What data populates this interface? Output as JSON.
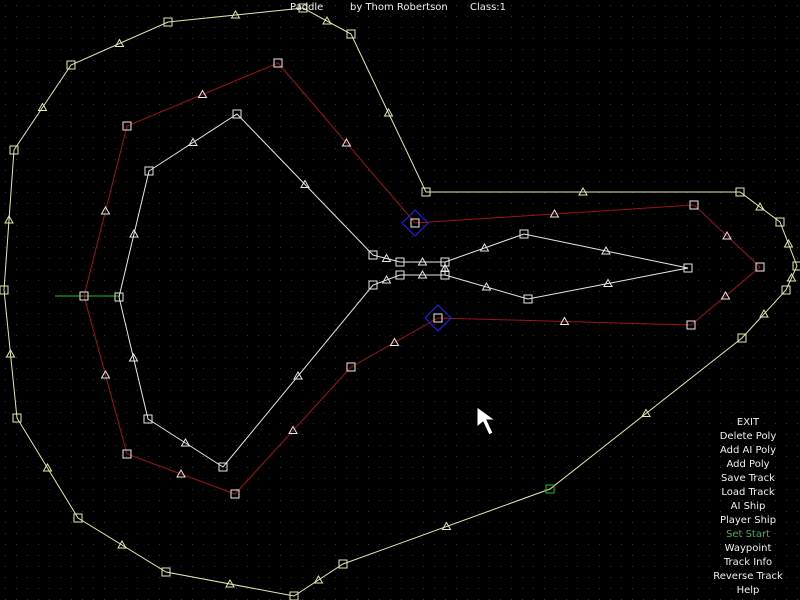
{
  "header": {
    "track_name": "Paddle",
    "author": "by Thom Robertson",
    "class_label": "Class:1"
  },
  "menu": {
    "items": [
      {
        "label": "EXIT"
      },
      {
        "label": "Delete Poly"
      },
      {
        "label": "Add AI Poly"
      },
      {
        "label": "Add Poly"
      },
      {
        "label": "Save Track"
      },
      {
        "label": "Load Track"
      },
      {
        "label": "AI Ship"
      },
      {
        "label": "Player Ship"
      },
      {
        "label": "Set Start",
        "active": true
      },
      {
        "label": "Waypoint"
      },
      {
        "label": "Track Info"
      },
      {
        "label": "Reverse Track"
      },
      {
        "label": "Help"
      }
    ]
  },
  "colors": {
    "outer_wall": "#e8e8b0",
    "inner_wall": "#e8e8e8",
    "ai_line": "#a01414",
    "start_line": "#22c022",
    "waypoint_marker": "#2222ff",
    "menu_text": "#f0f0f0",
    "menu_active": "#4caf50"
  },
  "icons": {
    "cursor": "arrow-pointer-icon",
    "vertex": "square-vertex-icon",
    "midpoint": "triangle-midpoint-icon",
    "waypoint": "diamond-waypoint-icon"
  }
}
